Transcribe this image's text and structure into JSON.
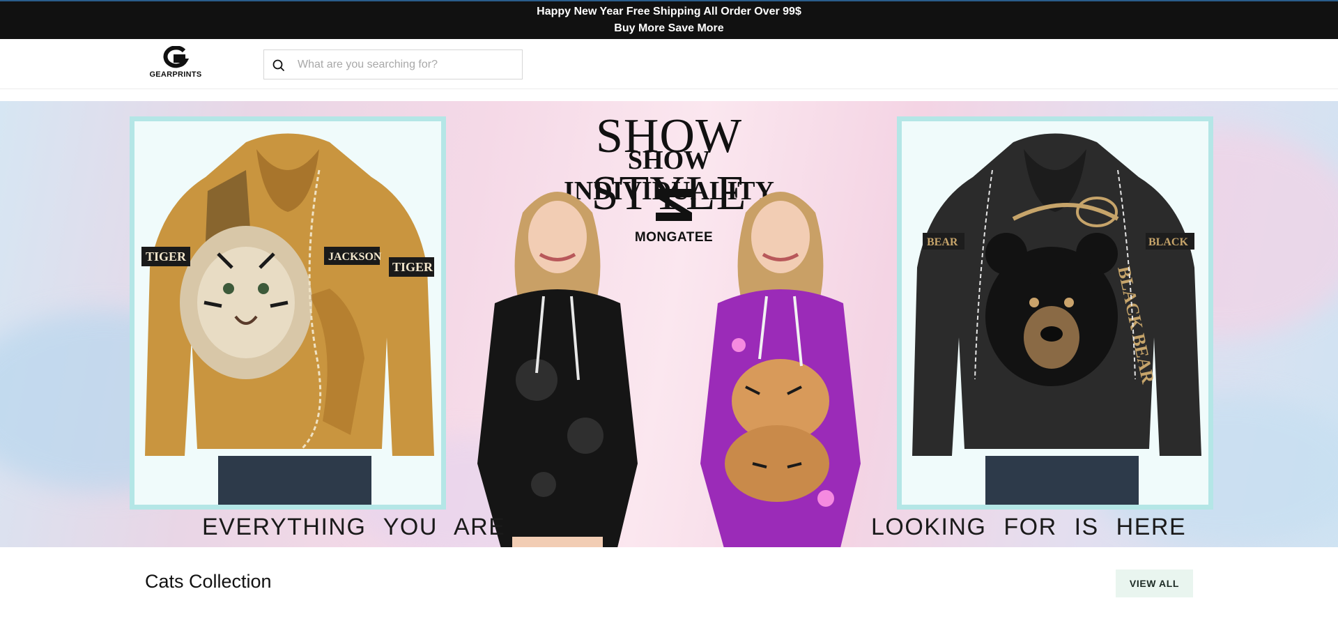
{
  "announcement": {
    "line1": "Happy New Year Free Shipping All Order Over 99$",
    "line2": "Buy More Save More"
  },
  "header": {
    "logo_text": "GEARPRINTS",
    "search": {
      "placeholder": "What are you searching for?",
      "value": ""
    }
  },
  "hero": {
    "headline_1": "SHOW STYLE",
    "headline_2": "SHOW INDIVIDUALITY",
    "brand": "MONGATEE",
    "tagline_left": "EVERYTHING YOU ARE",
    "tagline_right": "LOOKING FOR IS HERE",
    "left_product_text": [
      "TIGER",
      "JACKSON",
      "TIGER"
    ],
    "right_product_text": [
      "BEAR",
      "BLACK",
      "BLACK BEAR"
    ]
  },
  "section": {
    "title": "Cats Collection",
    "view_all_label": "VIEW ALL"
  },
  "colors": {
    "announcement_bg": "#111111",
    "frame_border": "#b4e6e6",
    "view_all_bg": "#e9f5ef",
    "tiger_hoodie": "#c9953f",
    "bear_hoodie": "#2b2b2b",
    "galaxy_dress": "#9b2bb8"
  }
}
